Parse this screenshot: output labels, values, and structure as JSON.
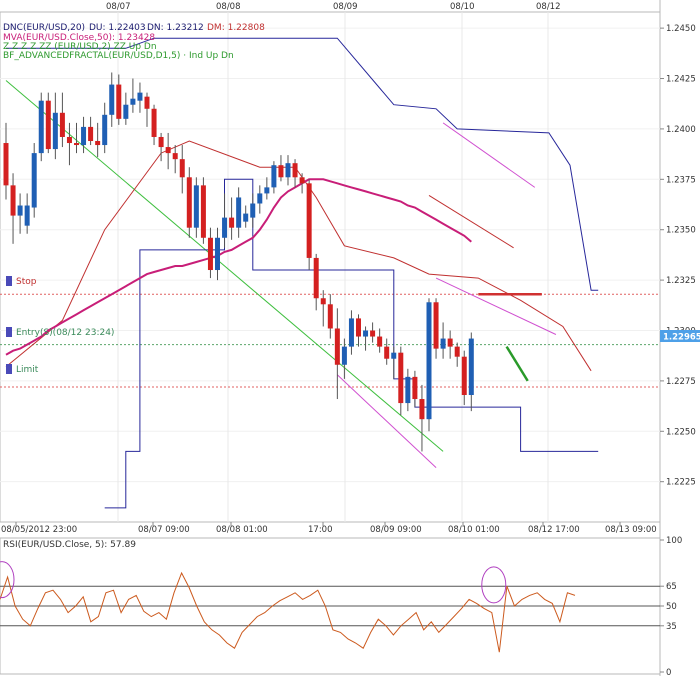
{
  "colors": {
    "bull": "#1f5fb4",
    "bear": "#d42020",
    "ma50": "#c81e78",
    "donchian_upper": "#27279a",
    "donchian_lower": "#27279a",
    "red_envelope": "#c03030",
    "fractal_line": "#3fbf3f",
    "channel": "#d050d0",
    "rsi": "#cc5a1e",
    "current_price_box": "#4ea0e8"
  },
  "legend": {
    "line1_prefix": "DNC(EUR/USD,20)",
    "line1_du": "DU: 1.22403",
    "line1_dn": "DN: 1.23212",
    "line1_dm": "DM: 1.22808",
    "line2": "MVA(EUR/USD.Close,50): 1.23428",
    "line3": "Z Z Z Z ZZ (EUR/USD,2) ZZ Up Dn",
    "line4": "BF_ADVANCEDFRACTAL(EUR/USD,D1,5) · Ind Up Dn"
  },
  "order_labels": {
    "stop": "Stop",
    "entry": "Entry(S)(08/12 23:24)",
    "limit": "Limit"
  },
  "current_price_label": "1.22965",
  "rsi_label": "RSI(EUR/USD.Close, 5): 57.89",
  "chart_data": [
    {
      "type": "candlestick",
      "title": "",
      "x_top_labels": [
        "08/07",
        "08/08",
        "08/09",
        "08/10",
        "08/12"
      ],
      "x_bottom_labels": [
        "08/05/2012 23:00",
        "08/07 09:00",
        "08/08 01:00",
        "17:00",
        "08/09 09:00",
        "08/10 01:00",
        "08/12 17:00",
        "08/13 09:00"
      ],
      "y_ticks": [
        "1.2450",
        "1.2425",
        "1.2400",
        "1.2375",
        "1.2350",
        "1.2325",
        "1.2300",
        "1.2275",
        "1.2250",
        "1.2225"
      ],
      "ylim": [
        1.2205,
        1.2458
      ],
      "candles": [
        {
          "o": 1.2393,
          "h": 1.2403,
          "l": 1.2365,
          "c": 1.2372
        },
        {
          "o": 1.2372,
          "h": 1.2378,
          "l": 1.2343,
          "c": 1.2357
        },
        {
          "o": 1.2357,
          "h": 1.2368,
          "l": 1.2348,
          "c": 1.2362
        },
        {
          "o": 1.2352,
          "h": 1.2368,
          "l": 1.2348,
          "c": 1.2362
        },
        {
          "o": 1.2361,
          "h": 1.2393,
          "l": 1.2356,
          "c": 1.2388
        },
        {
          "o": 1.2388,
          "h": 1.2418,
          "l": 1.2384,
          "c": 1.2414
        },
        {
          "o": 1.2414,
          "h": 1.2418,
          "l": 1.2388,
          "c": 1.239
        },
        {
          "o": 1.239,
          "h": 1.2418,
          "l": 1.2385,
          "c": 1.2408
        },
        {
          "o": 1.2408,
          "h": 1.2418,
          "l": 1.2391,
          "c": 1.2396
        },
        {
          "o": 1.2396,
          "h": 1.2403,
          "l": 1.2382,
          "c": 1.2393
        },
        {
          "o": 1.2393,
          "h": 1.2403,
          "l": 1.2388,
          "c": 1.2392
        },
        {
          "o": 1.2392,
          "h": 1.2406,
          "l": 1.2388,
          "c": 1.2401
        },
        {
          "o": 1.2401,
          "h": 1.2406,
          "l": 1.2392,
          "c": 1.2394
        },
        {
          "o": 1.2394,
          "h": 1.2403,
          "l": 1.2386,
          "c": 1.2392
        },
        {
          "o": 1.2392,
          "h": 1.2413,
          "l": 1.2388,
          "c": 1.2407
        },
        {
          "o": 1.2407,
          "h": 1.2428,
          "l": 1.2401,
          "c": 1.2422
        },
        {
          "o": 1.2422,
          "h": 1.2427,
          "l": 1.2402,
          "c": 1.2405
        },
        {
          "o": 1.2405,
          "h": 1.2418,
          "l": 1.2402,
          "c": 1.2412
        },
        {
          "o": 1.2412,
          "h": 1.2425,
          "l": 1.2408,
          "c": 1.2415
        },
        {
          "o": 1.2414,
          "h": 1.2423,
          "l": 1.2408,
          "c": 1.2418
        },
        {
          "o": 1.2416,
          "h": 1.2418,
          "l": 1.2401,
          "c": 1.241
        },
        {
          "o": 1.241,
          "h": 1.2412,
          "l": 1.2392,
          "c": 1.2396
        },
        {
          "o": 1.2396,
          "h": 1.2398,
          "l": 1.2384,
          "c": 1.2391
        },
        {
          "o": 1.2391,
          "h": 1.2398,
          "l": 1.238,
          "c": 1.2388
        },
        {
          "o": 1.2388,
          "h": 1.2392,
          "l": 1.2378,
          "c": 1.2385
        },
        {
          "o": 1.2385,
          "h": 1.2392,
          "l": 1.2368,
          "c": 1.2376
        },
        {
          "o": 1.2376,
          "h": 1.2381,
          "l": 1.2346,
          "c": 1.2351
        },
        {
          "o": 1.2351,
          "h": 1.2376,
          "l": 1.2346,
          "c": 1.2372
        },
        {
          "o": 1.2372,
          "h": 1.2376,
          "l": 1.2343,
          "c": 1.2346
        },
        {
          "o": 1.2346,
          "h": 1.2351,
          "l": 1.2326,
          "c": 1.233
        },
        {
          "o": 1.233,
          "h": 1.2351,
          "l": 1.2325,
          "c": 1.2346
        },
        {
          "o": 1.2346,
          "h": 1.2368,
          "l": 1.2341,
          "c": 1.2356
        },
        {
          "o": 1.2356,
          "h": 1.2366,
          "l": 1.2345,
          "c": 1.2351
        },
        {
          "o": 1.2351,
          "h": 1.2371,
          "l": 1.2346,
          "c": 1.2366
        },
        {
          "o": 1.2354,
          "h": 1.2362,
          "l": 1.2351,
          "c": 1.2358
        },
        {
          "o": 1.2356,
          "h": 1.2368,
          "l": 1.2351,
          "c": 1.2363
        },
        {
          "o": 1.2363,
          "h": 1.2372,
          "l": 1.2358,
          "c": 1.2368
        },
        {
          "o": 1.2368,
          "h": 1.2376,
          "l": 1.2365,
          "c": 1.2371
        },
        {
          "o": 1.2371,
          "h": 1.2384,
          "l": 1.2368,
          "c": 1.2382
        },
        {
          "o": 1.2382,
          "h": 1.2387,
          "l": 1.2374,
          "c": 1.2376
        },
        {
          "o": 1.2376,
          "h": 1.2387,
          "l": 1.2372,
          "c": 1.2383
        },
        {
          "o": 1.2383,
          "h": 1.2385,
          "l": 1.2371,
          "c": 1.2376
        },
        {
          "o": 1.2376,
          "h": 1.2378,
          "l": 1.2368,
          "c": 1.2373
        },
        {
          "o": 1.2373,
          "h": 1.2375,
          "l": 1.233,
          "c": 1.2336
        },
        {
          "o": 1.2336,
          "h": 1.2338,
          "l": 1.231,
          "c": 1.2316
        },
        {
          "o": 1.2316,
          "h": 1.232,
          "l": 1.2302,
          "c": 1.2313
        },
        {
          "o": 1.2313,
          "h": 1.2318,
          "l": 1.2296,
          "c": 1.2301
        },
        {
          "o": 1.2301,
          "h": 1.2311,
          "l": 1.2266,
          "c": 1.2283
        },
        {
          "o": 1.2283,
          "h": 1.2296,
          "l": 1.2276,
          "c": 1.2292
        },
        {
          "o": 1.2292,
          "h": 1.231,
          "l": 1.2288,
          "c": 1.2306
        },
        {
          "o": 1.2306,
          "h": 1.2308,
          "l": 1.2292,
          "c": 1.2297
        },
        {
          "o": 1.2297,
          "h": 1.2302,
          "l": 1.229,
          "c": 1.23
        },
        {
          "o": 1.23,
          "h": 1.2304,
          "l": 1.2294,
          "c": 1.2297
        },
        {
          "o": 1.2297,
          "h": 1.2301,
          "l": 1.2289,
          "c": 1.2292
        },
        {
          "o": 1.2292,
          "h": 1.2296,
          "l": 1.2283,
          "c": 1.2286
        },
        {
          "o": 1.2286,
          "h": 1.2292,
          "l": 1.2276,
          "c": 1.2289
        },
        {
          "o": 1.2289,
          "h": 1.2292,
          "l": 1.2258,
          "c": 1.2264
        },
        {
          "o": 1.2264,
          "h": 1.2281,
          "l": 1.226,
          "c": 1.2277
        },
        {
          "o": 1.2277,
          "h": 1.228,
          "l": 1.2262,
          "c": 1.2266
        },
        {
          "o": 1.2266,
          "h": 1.2273,
          "l": 1.224,
          "c": 1.2256
        },
        {
          "o": 1.2256,
          "h": 1.2316,
          "l": 1.225,
          "c": 1.2314
        },
        {
          "o": 1.2314,
          "h": 1.2316,
          "l": 1.2286,
          "c": 1.2291
        },
        {
          "o": 1.2291,
          "h": 1.2304,
          "l": 1.2286,
          "c": 1.2296
        },
        {
          "o": 1.2296,
          "h": 1.23,
          "l": 1.2286,
          "c": 1.2292
        },
        {
          "o": 1.2292,
          "h": 1.2294,
          "l": 1.2282,
          "c": 1.2287
        },
        {
          "o": 1.2287,
          "h": 1.229,
          "l": 1.2263,
          "c": 1.2268
        },
        {
          "o": 1.2268,
          "h": 1.2299,
          "l": 1.226,
          "c": 1.2296
        }
      ],
      "ma50": [
        1.2288,
        1.229,
        1.2291,
        1.2293,
        1.2295,
        1.2297,
        1.23,
        1.2302,
        1.2304,
        1.2306,
        1.2308,
        1.231,
        1.2312,
        1.2314,
        1.2316,
        1.2318,
        1.232,
        1.2322,
        1.2324,
        1.2326,
        1.2328,
        1.2329,
        1.233,
        1.2331,
        1.2332,
        1.2332,
        1.2333,
        1.2334,
        1.2335,
        1.2336,
        1.2337,
        1.2339,
        1.234,
        1.2342,
        1.2344,
        1.2346,
        1.235,
        1.2355,
        1.2361,
        1.2366,
        1.2369,
        1.2371,
        1.2373,
        1.2375,
        1.2375,
        1.2375,
        1.2374,
        1.2373,
        1.2372,
        1.2371,
        1.237,
        1.2369,
        1.2368,
        1.2367,
        1.2366,
        1.2365,
        1.2364,
        1.2362,
        1.2361,
        1.2359,
        1.2357,
        1.2355,
        1.2353,
        1.2351,
        1.2349,
        1.2347,
        1.2344
      ],
      "donchian_upper": [
        [
          0,
          1.244
        ],
        [
          17,
          1.244
        ],
        [
          21,
          1.2445
        ],
        [
          47,
          1.2445
        ],
        [
          55,
          1.2412
        ],
        [
          61,
          1.241
        ],
        [
          64,
          1.24
        ],
        [
          77,
          1.2398
        ],
        [
          80,
          1.2382
        ],
        [
          83,
          1.232
        ],
        [
          84,
          1.232
        ]
      ],
      "donchian_lower": [
        [
          14,
          1.2212
        ],
        [
          17,
          1.224
        ],
        [
          19,
          1.234
        ],
        [
          27,
          1.234
        ],
        [
          31,
          1.2375
        ],
        [
          35,
          1.233
        ],
        [
          47,
          1.233
        ],
        [
          55,
          1.2276
        ],
        [
          58,
          1.2262
        ],
        [
          67,
          1.2262
        ],
        [
          73,
          1.224
        ],
        [
          84,
          1.224
        ]
      ],
      "red_envelope": [
        [
          0,
          1.2282
        ],
        [
          8,
          1.2305
        ],
        [
          14,
          1.235
        ],
        [
          22,
          1.2388
        ],
        [
          26,
          1.2394
        ],
        [
          36,
          1.2381
        ],
        [
          41,
          1.2381
        ],
        [
          44,
          1.2366
        ],
        [
          48,
          1.2342
        ],
        [
          55,
          1.2336
        ],
        [
          60,
          1.2328
        ],
        [
          67,
          1.2326
        ],
        [
          73,
          1.2315
        ],
        [
          79,
          1.2302
        ],
        [
          83,
          1.228
        ]
      ],
      "fractal_line": [
        [
          0,
          1.2424
        ],
        [
          62,
          1.224
        ]
      ],
      "channel_upper": [
        [
          62,
          1.2403
        ],
        [
          75,
          1.2371
        ]
      ],
      "channel_mid": [
        [
          60,
          1.2367
        ],
        [
          72,
          1.2341
        ]
      ],
      "channel_lower_a": [
        [
          61,
          1.2326
        ],
        [
          78,
          1.2298
        ]
      ],
      "channel_lower_b": [
        [
          47,
          1.2278
        ],
        [
          61,
          1.2232
        ]
      ],
      "stop_level": 1.2318,
      "entry_level": 1.2293,
      "limit_level": 1.2272,
      "stop_mark": [
        [
          67,
          1.2318
        ],
        [
          76,
          1.2318
        ]
      ],
      "current_price": 1.22965,
      "forecast_arrow": [
        [
          71,
          1.2292
        ],
        [
          74,
          1.2275
        ]
      ]
    },
    {
      "type": "line",
      "title": "",
      "y_ticks": [
        "100",
        "65",
        "50",
        "35",
        "0"
      ],
      "ylim": [
        0,
        100
      ],
      "levels": [
        65,
        50,
        35
      ],
      "series": [
        {
          "values": [
            55,
            72,
            50,
            40,
            35,
            48,
            60,
            62,
            55,
            45,
            50,
            57,
            38,
            42,
            60,
            62,
            45,
            55,
            58,
            46,
            42,
            45,
            40,
            60,
            75,
            64,
            50,
            38,
            32,
            28,
            22,
            18,
            30,
            36,
            42,
            45,
            50,
            54,
            57,
            60,
            55,
            58,
            62,
            50,
            32,
            30,
            25,
            22,
            18,
            30,
            40,
            35,
            28,
            35,
            40,
            45,
            32,
            38,
            30,
            36,
            42,
            48,
            55,
            52,
            48,
            45,
            15,
            65,
            50,
            55,
            58,
            60,
            55,
            52,
            38,
            60,
            58
          ]
        }
      ],
      "circles": [
        [
          0,
          70
        ],
        [
          65,
          66
        ]
      ]
    }
  ]
}
